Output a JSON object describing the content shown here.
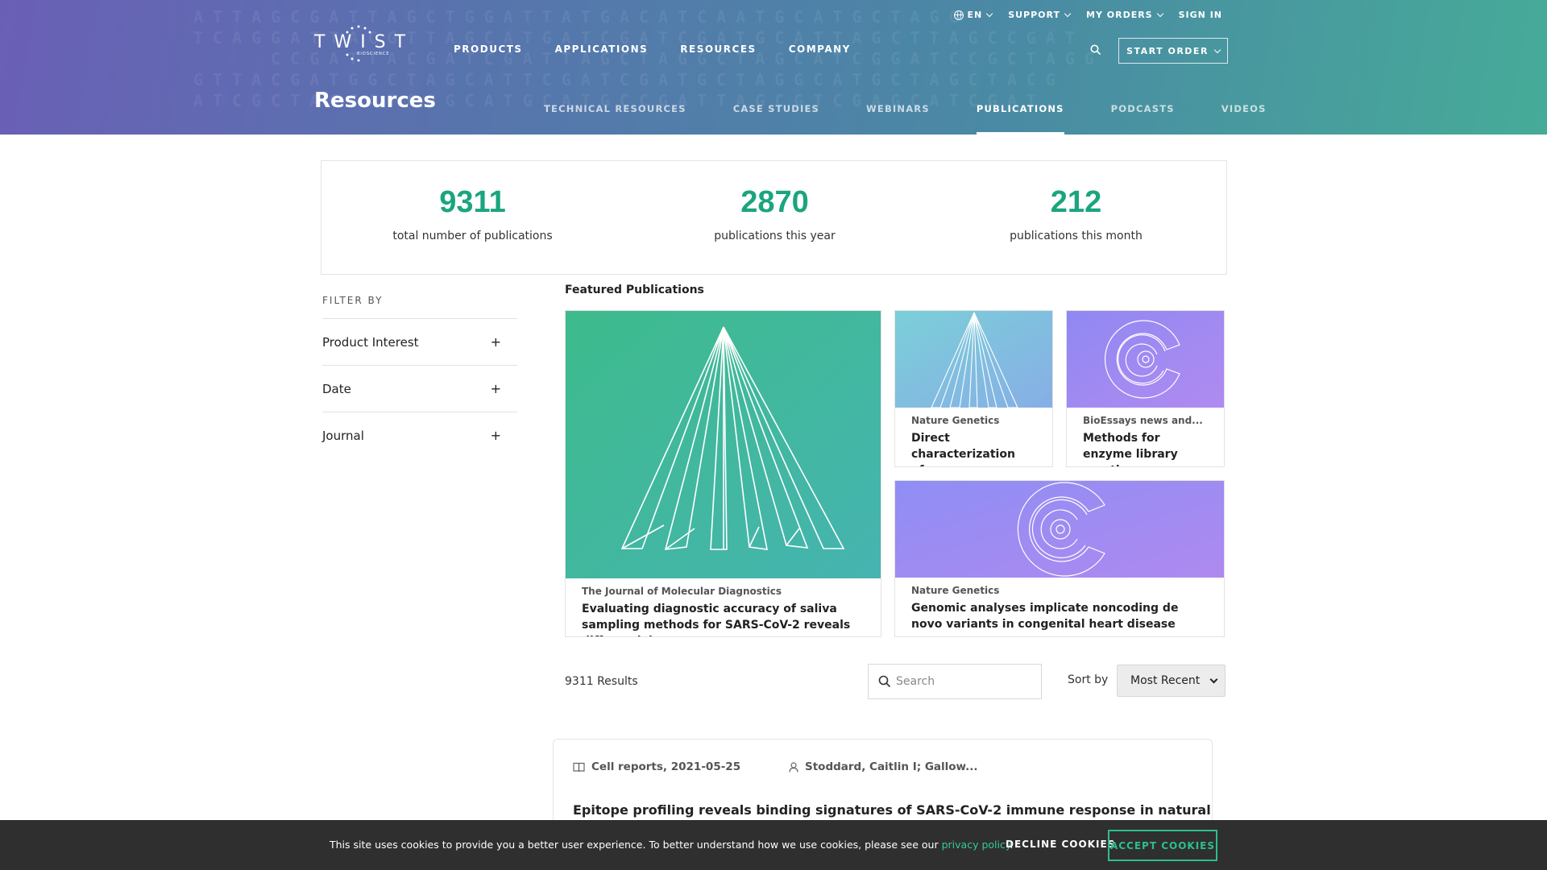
{
  "header": {
    "utility": {
      "language": "EN",
      "support": "SUPPORT",
      "my_orders": "MY ORDERS",
      "sign_in": "SIGN IN"
    },
    "logo": {
      "wordmark": "TWIST",
      "sub": "BIOSCIENCE"
    },
    "main_nav": [
      "PRODUCTS",
      "APPLICATIONS",
      "RESOURCES",
      "COMPANY"
    ],
    "start_order": "START ORDER",
    "page_title": "Resources",
    "sub_nav": [
      {
        "label": "TECHNICAL RESOURCES",
        "active": false
      },
      {
        "label": "CASE STUDIES",
        "active": false
      },
      {
        "label": "WEBINARS",
        "active": false
      },
      {
        "label": "PUBLICATIONS",
        "active": true
      },
      {
        "label": "PODCASTS",
        "active": false
      },
      {
        "label": "VIDEOS",
        "active": false
      }
    ],
    "gradient_colors": [
      "#6a5fb6",
      "#46ab98"
    ]
  },
  "stats": [
    {
      "value": "9311",
      "label": "total number of publications"
    },
    {
      "value": "2870",
      "label": "publications this year"
    },
    {
      "value": "212",
      "label": "publications this month"
    }
  ],
  "accent_color": "#1aa57f",
  "filter": {
    "title": "FILTER BY",
    "items": [
      "Product Interest",
      "Date",
      "Journal"
    ],
    "expand_symbol": "+"
  },
  "featured": {
    "title": "Featured Publications",
    "cards": [
      {
        "journal": "The Journal of Molecular Diagnostics",
        "title": "Evaluating diagnostic accuracy of saliva sampling methods for SARS-CoV-2 reveals differential...",
        "image": "cone-lines-green"
      },
      {
        "journal": "Nature Genetics",
        "title": "Direct characterization of...",
        "image": "cone-lines-blue"
      },
      {
        "journal": "BioEssays news and...",
        "title": "Methods for enzyme library creation:...",
        "image": "spiral-purple"
      },
      {
        "journal": "Nature Genetics",
        "title": "Genomic analyses implicate noncoding de novo variants in congenital heart disease",
        "image": "spiral-purple"
      }
    ]
  },
  "results": {
    "count_text": "9311 Results",
    "search_placeholder": "Search",
    "sort_label": "Sort by",
    "sort_value": "Most Recent"
  },
  "publications": [
    {
      "journal_date": "Cell reports, 2021-05-25",
      "authors": "Stoddard, Caitlin I; Gallow...",
      "title": "Epitope profiling reveals binding signatures of SARS-CoV-2 immune response in natural infection"
    }
  ],
  "cookie": {
    "text": "This site uses cookies to provide you a better user experience. To better understand how we use cookies, please see our",
    "link": "privacy policy",
    "decline": "DECLINE COOKIES",
    "accept": "ACCEPT COOKIES"
  }
}
